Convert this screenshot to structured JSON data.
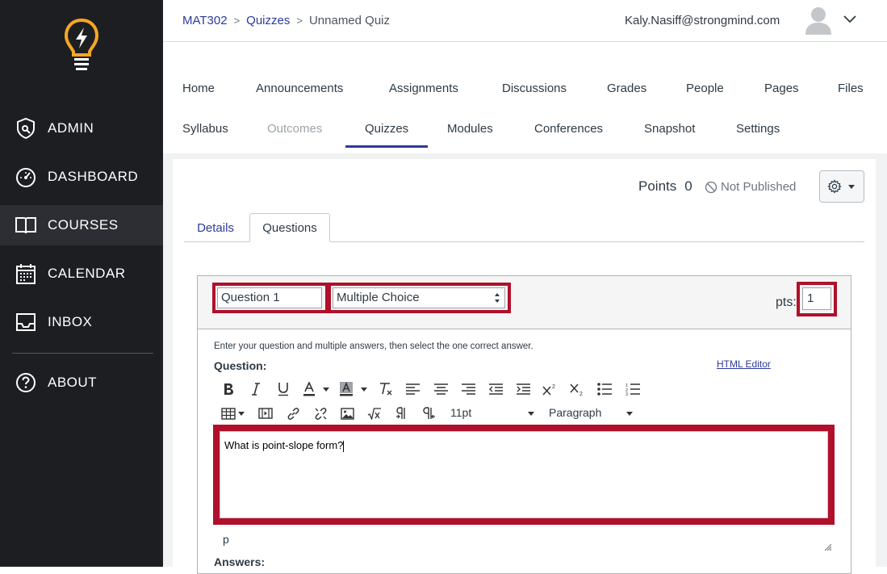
{
  "sidebar": {
    "items": [
      {
        "label": "ADMIN",
        "icon": "admin-shield-icon"
      },
      {
        "label": "DASHBOARD",
        "icon": "dashboard-gauge-icon"
      },
      {
        "label": "COURSES",
        "icon": "courses-book-icon"
      },
      {
        "label": "CALENDAR",
        "icon": "calendar-icon"
      },
      {
        "label": "INBOX",
        "icon": "inbox-icon"
      },
      {
        "label": "ABOUT",
        "icon": "help-circle-icon"
      }
    ],
    "active": "COURSES",
    "brand_color": "#f5a623"
  },
  "breadcrumb": {
    "course": "MAT302",
    "section": "Quizzes",
    "current": "Unnamed Quiz"
  },
  "user": {
    "email": "Kaly.Nasiff@strongmind.com"
  },
  "course_nav": {
    "row1": [
      "Home",
      "Announcements",
      "Assignments",
      "Discussions",
      "Grades",
      "People",
      "Pages",
      "Files"
    ],
    "row2": [
      "Syllabus",
      "Outcomes",
      "Quizzes",
      "Modules",
      "Conferences",
      "Snapshot",
      "Settings"
    ],
    "active": "Quizzes",
    "disabled": [
      "Outcomes"
    ]
  },
  "quiz": {
    "points_label": "Points",
    "points_value": "0",
    "publish_status": "Not Published",
    "tabs": [
      "Details",
      "Questions"
    ],
    "active_tab": "Questions"
  },
  "question": {
    "name": "Question 1",
    "type": "Multiple Choice",
    "pts_label": "pts:",
    "pts_value": "1",
    "instructions": "Enter your question and multiple answers, then select the one correct answer.",
    "html_editor_link": "HTML Editor",
    "question_label": "Question:",
    "font_size": "11pt",
    "block_format": "Paragraph",
    "text": "What is point-slope form?",
    "path": "p",
    "answers_label": "Answers:"
  },
  "colors": {
    "highlight_border": "#b0102b",
    "link": "#2d3b9a",
    "sidebar_bg": "#1d1e22"
  }
}
